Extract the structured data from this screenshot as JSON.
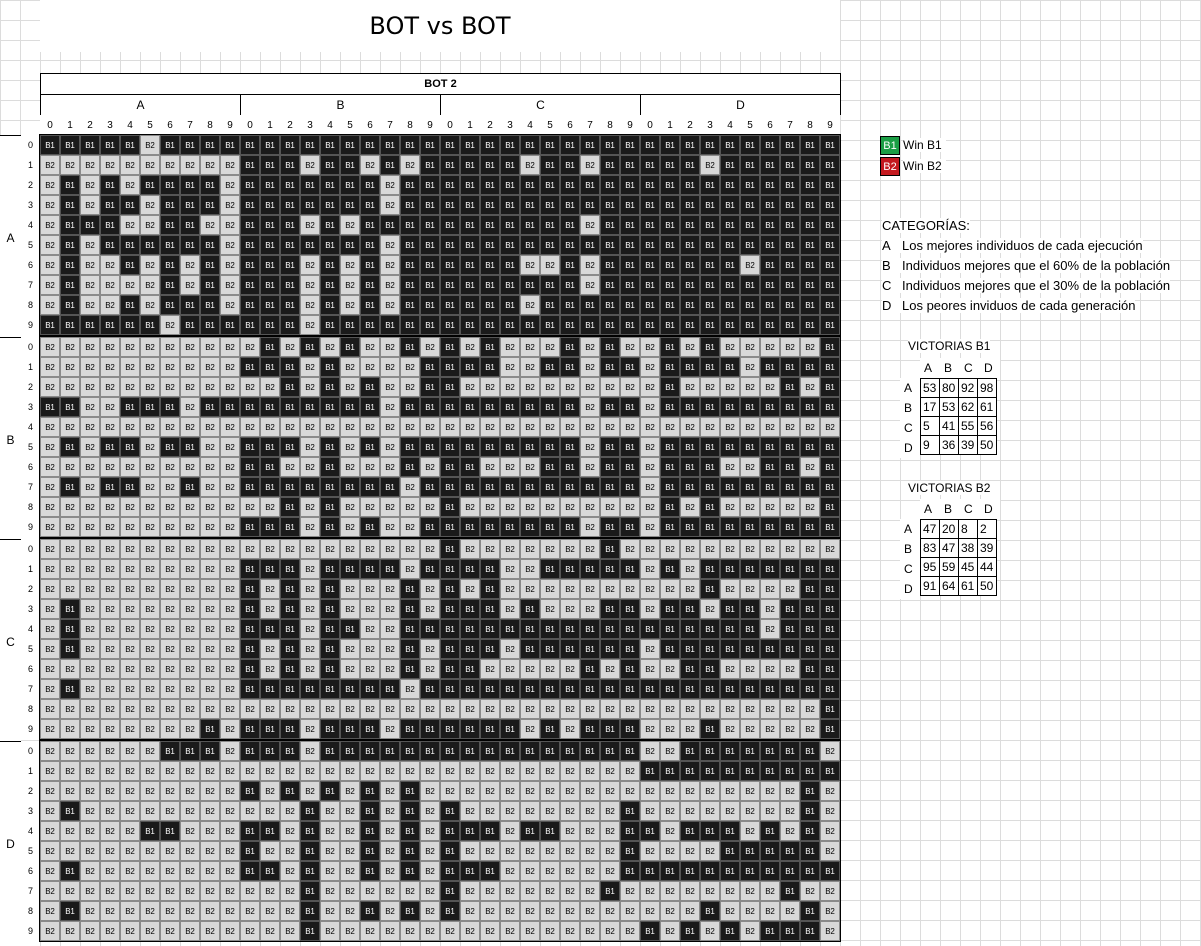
{
  "title": "BOT vs BOT",
  "matrix": {
    "header": "BOT 2",
    "categories": [
      "A",
      "B",
      "C",
      "D"
    ],
    "indices": [
      "0",
      "1",
      "2",
      "3",
      "4",
      "5",
      "6",
      "7",
      "8",
      "9"
    ],
    "rows": [
      "B1 B1 B1 B1 B1 B2 B1 B1 B1 B1 B1 B1 B1 B1 B1 B1 B1 B1 B1 B1 B1 B1 B1 B1 B1 B1 B1 B1 B1 B1 B1 B1 B1 B1 B1 B1 B1 B1 B1 B1",
      "B2 B2 B2 B2 B2 B2 B2 B2 B2 B2 B1 B1 B1 B2 B1 B1 B2 B1 B2 B1 B1 B1 B1 B1 B2 B1 B1 B2 B1 B1 B1 B1 B1 B2 B1 B1 B1 B1 B1 B1",
      "B2 B1 B2 B1 B2 B1 B1 B1 B1 B2 B1 B1 B1 B1 B1 B1 B1 B2 B1 B1 B1 B1 B1 B1 B1 B1 B1 B1 B1 B1 B1 B1 B1 B1 B1 B1 B1 B1 B1 B1",
      "B2 B1 B2 B1 B1 B2 B1 B1 B1 B2 B1 B1 B1 B1 B1 B1 B1 B2 B1 B1 B1 B1 B1 B1 B1 B1 B1 B1 B1 B1 B1 B1 B1 B1 B1 B1 B1 B1 B1 B1",
      "B2 B1 B1 B1 B2 B2 B1 B1 B2 B2 B1 B1 B1 B2 B1 B2 B1 B1 B1 B1 B1 B1 B1 B1 B1 B1 B1 B2 B1 B1 B1 B1 B1 B1 B1 B1 B1 B1 B1 B1",
      "B2 B1 B2 B1 B1 B1 B1 B1 B1 B2 B1 B1 B1 B1 B1 B1 B1 B2 B1 B1 B1 B1 B1 B1 B1 B1 B1 B1 B1 B1 B1 B1 B1 B1 B1 B1 B1 B1 B1 B1",
      "B2 B1 B2 B2 B1 B2 B1 B2 B1 B2 B1 B1 B1 B2 B1 B2 B1 B2 B1 B1 B1 B1 B1 B1 B2 B2 B1 B2 B1 B1 B1 B1 B1 B1 B1 B2 B1 B1 B1 B1",
      "B2 B1 B2 B2 B2 B2 B1 B2 B1 B2 B1 B1 B1 B2 B1 B2 B1 B2 B1 B1 B1 B1 B1 B1 B1 B1 B1 B2 B1 B1 B1 B1 B1 B1 B1 B1 B1 B1 B1 B1",
      "B2 B1 B2 B2 B1 B2 B1 B1 B1 B2 B1 B1 B1 B2 B1 B2 B1 B2 B1 B1 B1 B1 B1 B1 B2 B1 B1 B1 B1 B1 B1 B1 B1 B1 B1 B1 B1 B1 B1 B1",
      "B1 B1 B1 B1 B1 B1 B2 B1 B1 B1 B1 B1 B1 B2 B1 B1 B1 B1 B1 B1 B1 B1 B1 B1 B1 B1 B1 B1 B1 B1 B1 B1 B1 B1 B1 B1 B1 B1 B1 B1",
      "B2 B2 B2 B2 B2 B2 B2 B2 B2 B2 B2 B1 B2 B1 B2 B1 B2 B2 B1 B2 B1 B2 B1 B2 B2 B2 B1 B2 B1 B2 B2 B1 B2 B1 B2 B2 B2 B2 B2 B1",
      "B2 B2 B2 B2 B2 B2 B2 B2 B2 B2 B1 B1 B1 B2 B1 B2 B2 B2 B2 B1 B1 B1 B1 B2 B2 B1 B1 B2 B1 B1 B2 B1 B1 B1 B1 B2 B1 B1 B1 B1",
      "B2 B2 B2 B2 B2 B2 B2 B2 B2 B2 B2 B2 B1 B2 B1 B2 B1 B2 B2 B1 B1 B2 B2 B2 B2 B2 B2 B2 B2 B2 B2 B1 B2 B2 B2 B2 B2 B1 B2 B1",
      "B1 B1 B2 B2 B1 B1 B1 B2 B1 B1 B1 B1 B1 B1 B1 B1 B1 B2 B1 B1 B1 B1 B1 B1 B1 B1 B1 B2 B1 B1 B2 B1 B1 B1 B1 B1 B1 B1 B1 B1",
      "B2 B2 B2 B2 B2 B2 B2 B2 B2 B2 B2 B2 B2 B2 B2 B2 B2 B2 B2 B2 B2 B2 B2 B2 B2 B2 B2 B2 B2 B2 B2 B2 B2 B2 B2 B2 B2 B2 B2 B2",
      "B2 B1 B2 B1 B1 B2 B1 B1 B2 B2 B1 B1 B1 B2 B1 B2 B1 B2 B1 B1 B1 B1 B1 B1 B1 B1 B1 B2 B1 B1 B2 B1 B1 B1 B1 B1 B1 B1 B1 B1",
      "B2 B2 B2 B2 B2 B2 B2 B2 B2 B2 B1 B1 B2 B2 B1 B2 B2 B2 B1 B2 B1 B1 B2 B2 B2 B1 B1 B2 B1 B1 B2 B1 B1 B1 B2 B2 B1 B1 B2 B1",
      "B2 B1 B2 B1 B1 B2 B2 B1 B2 B2 B1 B1 B1 B1 B1 B1 B1 B1 B2 B1 B1 B1 B1 B1 B1 B1 B1 B1 B1 B1 B2 B1 B1 B1 B1 B1 B1 B1 B1 B1",
      "B2 B2 B2 B2 B2 B2 B2 B2 B2 B2 B2 B2 B1 B2 B1 B2 B2 B2 B2 B2 B1 B2 B2 B2 B2 B2 B2 B2 B2 B2 B2 B1 B2 B1 B2 B2 B2 B2 B2 B1",
      "B2 B2 B2 B2 B2 B2 B2 B2 B2 B2 B1 B1 B1 B2 B1 B2 B1 B2 B2 B1 B1 B1 B1 B1 B1 B1 B1 B2 B1 B1 B2 B1 B1 B1 B1 B1 B1 B1 B1 B1",
      "B2 B2 B2 B2 B2 B2 B2 B2 B2 B2 B2 B2 B2 B2 B2 B2 B2 B2 B2 B2 B1 B2 B2 B2 B2 B2 B2 B2 B1 B2 B2 B2 B2 B2 B2 B2 B2 B2 B2 B2",
      "B2 B2 B2 B2 B2 B2 B2 B2 B2 B2 B1 B1 B1 B2 B1 B1 B1 B1 B2 B1 B1 B1 B1 B2 B2 B1 B1 B1 B1 B1 B2 B1 B2 B1 B1 B1 B1 B1 B1 B1",
      "B2 B2 B2 B2 B2 B2 B2 B2 B2 B2 B1 B2 B1 B2 B1 B2 B2 B2 B1 B2 B1 B2 B1 B2 B2 B2 B2 B2 B2 B2 B2 B2 B2 B1 B2 B2 B2 B2 B1 B1",
      "B2 B1 B2 B2 B2 B2 B2 B2 B2 B2 B1 B2 B1 B2 B1 B2 B2 B2 B1 B2 B1 B1 B1 B2 B1 B2 B2 B2 B1 B1 B2 B1 B1 B2 B1 B1 B2 B1 B1 B1",
      "B2 B1 B2 B2 B2 B2 B2 B2 B2 B2 B1 B1 B1 B2 B1 B1 B2 B2 B1 B1 B1 B1 B1 B1 B1 B1 B1 B1 B1 B1 B1 B1 B1 B1 B1 B1 B2 B1 B1 B1",
      "B2 B1 B2 B2 B2 B2 B2 B2 B2 B2 B1 B2 B1 B2 B1 B2 B2 B2 B1 B2 B1 B1 B1 B2 B1 B1 B1 B1 B1 B1 B2 B1 B1 B1 B1 B1 B1 B1 B1 B1",
      "B2 B2 B2 B2 B2 B2 B2 B2 B2 B2 B1 B2 B1 B2 B1 B2 B2 B2 B1 B2 B1 B1 B2 B2 B2 B2 B2 B1 B2 B1 B2 B2 B1 B1 B2 B2 B2 B2 B1 B1",
      "B2 B1 B2 B2 B2 B2 B2 B2 B2 B2 B1 B1 B1 B1 B1 B1 B1 B1 B2 B1 B1 B1 B1 B1 B1 B1 B1 B1 B1 B1 B1 B1 B1 B1 B1 B1 B1 B1 B1 B1",
      "B2 B2 B2 B2 B2 B2 B2 B2 B2 B2 B2 B2 B2 B2 B2 B2 B2 B2 B2 B2 B2 B2 B2 B2 B2 B2 B2 B2 B2 B2 B2 B2 B2 B2 B2 B2 B2 B2 B2 B1",
      "B2 B2 B2 B2 B2 B2 B2 B2 B1 B2 B1 B1 B1 B2 B1 B1 B1 B2 B1 B1 B1 B1 B1 B1 B2 B1 B2 B1 B1 B1 B2 B2 B2 B1 B2 B2 B2 B2 B2 B1",
      "B2 B2 B2 B2 B2 B2 B1 B1 B1 B2 B1 B1 B1 B2 B1 B1 B1 B1 B1 B1 B1 B1 B1 B1 B1 B1 B1 B1 B1 B1 B2 B2 B1 B1 B1 B1 B1 B1 B1 B2",
      "B2 B2 B2 B2 B2 B2 B2 B2 B2 B2 B2 B2 B2 B2 B2 B2 B2 B2 B2 B2 B2 B2 B2 B2 B2 B2 B2 B2 B2 B2 B1 B1 B1 B1 B1 B1 B1 B1 B1 B1",
      "B2 B2 B2 B2 B2 B2 B2 B2 B2 B2 B1 B2 B1 B2 B1 B2 B1 B2 B1 B2 B2 B2 B2 B2 B2 B2 B2 B2 B2 B2 B2 B2 B2 B2 B2 B2 B2 B2 B1 B2",
      "B2 B1 B2 B2 B2 B2 B2 B2 B2 B2 B2 B2 B2 B1 B2 B2 B1 B2 B1 B2 B1 B2 B2 B2 B2 B2 B2 B2 B2 B1 B2 B2 B2 B2 B2 B2 B2 B2 B1 B2",
      "B2 B2 B2 B2 B2 B1 B1 B2 B2 B2 B1 B1 B2 B1 B2 B2 B1 B2 B1 B2 B1 B1 B1 B2 B1 B1 B2 B2 B2 B1 B1 B2 B1 B1 B1 B2 B1 B2 B1 B2",
      "B2 B2 B2 B2 B2 B2 B2 B2 B2 B2 B1 B2 B2 B1 B2 B2 B1 B2 B1 B2 B1 B2 B2 B2 B2 B2 B2 B2 B2 B1 B2 B2 B2 B2 B1 B1 B1 B1 B1 B2",
      "B2 B1 B2 B2 B2 B2 B2 B2 B2 B2 B1 B1 B2 B1 B2 B2 B1 B2 B1 B2 B1 B1 B1 B2 B2 B2 B2 B2 B2 B1 B1 B1 B1 B1 B1 B1 B1 B1 B1 B1",
      "B2 B2 B2 B2 B2 B2 B2 B2 B2 B2 B2 B2 B2 B1 B2 B2 B2 B2 B2 B2 B1 B2 B2 B2 B2 B2 B2 B2 B1 B2 B2 B2 B2 B2 B2 B2 B2 B1 B2 B2",
      "B2 B1 B2 B2 B2 B2 B2 B2 B2 B2 B2 B2 B2 B1 B2 B2 B1 B2 B1 B2 B1 B2 B2 B2 B2 B2 B2 B2 B2 B2 B2 B2 B2 B1 B2 B2 B2 B2 B1 B2",
      "B2 B2 B2 B2 B2 B2 B2 B2 B2 B2 B2 B2 B2 B1 B2 B2 B2 B2 B2 B2 B2 B2 B2 B2 B2 B2 B2 B2 B2 B2 B1 B2 B1 B2 B1 B2 B1 B1 B1 B2"
    ]
  },
  "legend": {
    "b1": {
      "code": "B1",
      "label": "Win B1",
      "color": "#1b9e45"
    },
    "b2": {
      "code": "B2",
      "label": "Win B2",
      "color": "#c4191f"
    }
  },
  "categories_block": {
    "heading": "CATEGORÍAS:",
    "items": [
      {
        "key": "A",
        "text": "Los mejores individuos de cada ejecución"
      },
      {
        "key": "B",
        "text": "Individuos mejores que el 60% de la población"
      },
      {
        "key": "C",
        "text": "Individuos mejores que el 30% de la población"
      },
      {
        "key": "D",
        "text": "Los peores inviduos de cada generación"
      }
    ]
  },
  "victorias_b1": {
    "title": "VICTORIAS B1",
    "cols": [
      "A",
      "B",
      "C",
      "D"
    ],
    "rows": [
      {
        "label": "A",
        "values": [
          "53",
          "80",
          "92",
          "98"
        ]
      },
      {
        "label": "B",
        "values": [
          "17",
          "53",
          "62",
          "61"
        ]
      },
      {
        "label": "C",
        "values": [
          "5",
          "41",
          "55",
          "56"
        ]
      },
      {
        "label": "D",
        "values": [
          "9",
          "36",
          "39",
          "50"
        ]
      }
    ]
  },
  "victorias_b2": {
    "title": "VICTORIAS B2",
    "cols": [
      "A",
      "B",
      "C",
      "D"
    ],
    "rows": [
      {
        "label": "A",
        "values": [
          "47",
          "20",
          "8",
          "2"
        ]
      },
      {
        "label": "B",
        "values": [
          "83",
          "47",
          "38",
          "39"
        ]
      },
      {
        "label": "C",
        "values": [
          "95",
          "59",
          "45",
          "44"
        ]
      },
      {
        "label": "D",
        "values": [
          "91",
          "64",
          "61",
          "50"
        ]
      }
    ]
  }
}
